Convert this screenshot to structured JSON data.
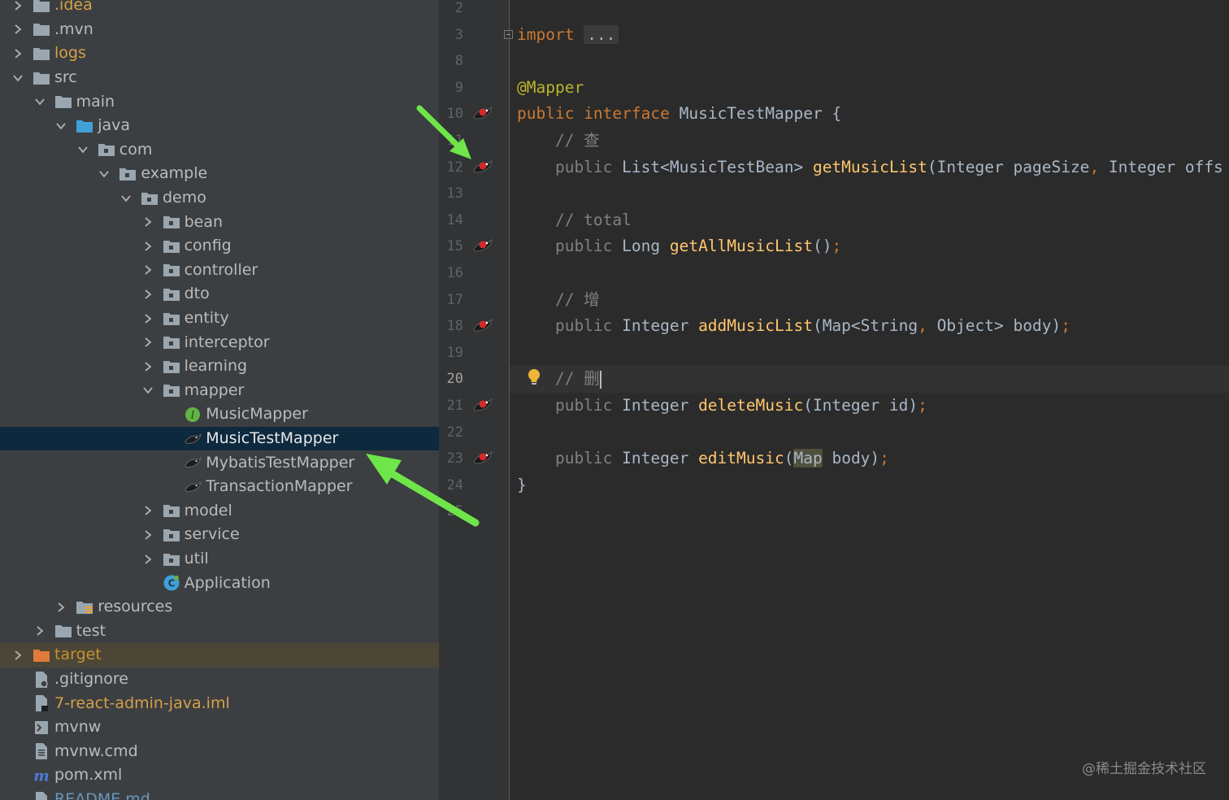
{
  "project_tree": {
    "rows": [
      {
        "label": ".idea",
        "depth": 0,
        "chev": "right",
        "icon": "folder-icon",
        "color": "orange"
      },
      {
        "label": ".mvn",
        "depth": 0,
        "chev": "right",
        "icon": "folder-icon",
        "color": "normal"
      },
      {
        "label": "logs",
        "depth": 0,
        "chev": "right",
        "icon": "folder-icon",
        "color": "orange"
      },
      {
        "label": "src",
        "depth": 0,
        "chev": "down",
        "icon": "folder-icon",
        "color": "normal"
      },
      {
        "label": "main",
        "depth": 1,
        "chev": "down",
        "icon": "folder-icon",
        "color": "normal"
      },
      {
        "label": "java",
        "depth": 2,
        "chev": "down",
        "icon": "source-folder-icon",
        "color": "normal"
      },
      {
        "label": "com",
        "depth": 3,
        "chev": "down",
        "icon": "package-icon",
        "color": "normal"
      },
      {
        "label": "example",
        "depth": 4,
        "chev": "down",
        "icon": "package-icon",
        "color": "normal"
      },
      {
        "label": "demo",
        "depth": 5,
        "chev": "down",
        "icon": "package-icon",
        "color": "normal"
      },
      {
        "label": "bean",
        "depth": 6,
        "chev": "right",
        "icon": "package-icon",
        "color": "normal"
      },
      {
        "label": "config",
        "depth": 6,
        "chev": "right",
        "icon": "package-icon",
        "color": "normal"
      },
      {
        "label": "controller",
        "depth": 6,
        "chev": "right",
        "icon": "package-icon",
        "color": "normal"
      },
      {
        "label": "dto",
        "depth": 6,
        "chev": "right",
        "icon": "package-icon",
        "color": "normal"
      },
      {
        "label": "entity",
        "depth": 6,
        "chev": "right",
        "icon": "package-icon",
        "color": "normal"
      },
      {
        "label": "interceptor",
        "depth": 6,
        "chev": "right",
        "icon": "package-icon",
        "color": "normal"
      },
      {
        "label": "learning",
        "depth": 6,
        "chev": "right",
        "icon": "package-icon",
        "color": "normal"
      },
      {
        "label": "mapper",
        "depth": 6,
        "chev": "down",
        "icon": "package-icon",
        "color": "normal"
      },
      {
        "label": "MusicMapper",
        "depth": 7,
        "chev": "none",
        "icon": "interface-icon",
        "color": "normal"
      },
      {
        "label": "MusicTestMapper",
        "depth": 7,
        "chev": "none",
        "icon": "mybatis-bird-icon",
        "color": "normal",
        "selected": true
      },
      {
        "label": "MybatisTestMapper",
        "depth": 7,
        "chev": "none",
        "icon": "mybatis-bird-icon",
        "color": "normal"
      },
      {
        "label": "TransactionMapper",
        "depth": 7,
        "chev": "none",
        "icon": "mybatis-bird-icon",
        "color": "normal"
      },
      {
        "label": "model",
        "depth": 6,
        "chev": "right",
        "icon": "package-icon",
        "color": "normal"
      },
      {
        "label": "service",
        "depth": 6,
        "chev": "right",
        "icon": "package-icon",
        "color": "normal"
      },
      {
        "label": "util",
        "depth": 6,
        "chev": "right",
        "icon": "package-icon",
        "color": "normal"
      },
      {
        "label": "Application",
        "depth": 6,
        "chev": "none",
        "icon": "spring-class-icon",
        "color": "normal"
      },
      {
        "label": "resources",
        "depth": 2,
        "chev": "right",
        "icon": "resources-folder-icon",
        "color": "normal"
      },
      {
        "label": "test",
        "depth": 1,
        "chev": "right",
        "icon": "folder-icon",
        "color": "normal"
      },
      {
        "label": "target",
        "depth": 0,
        "chev": "right",
        "icon": "excluded-folder-icon",
        "color": "target",
        "excluded": true
      },
      {
        "label": ".gitignore",
        "depth": 0,
        "chev": "none",
        "icon": "gitignore-file-icon",
        "color": "normal"
      },
      {
        "label": "7-react-admin-java.iml",
        "depth": 0,
        "chev": "none",
        "icon": "iml-file-icon",
        "color": "orange"
      },
      {
        "label": "mvnw",
        "depth": 0,
        "chev": "none",
        "icon": "shell-file-icon",
        "color": "normal"
      },
      {
        "label": "mvnw.cmd",
        "depth": 0,
        "chev": "none",
        "icon": "text-file-icon",
        "color": "normal"
      },
      {
        "label": "pom.xml",
        "depth": 0,
        "chev": "none",
        "icon": "maven-icon",
        "color": "normal"
      },
      {
        "label": "README.md",
        "depth": 0,
        "chev": "none",
        "icon": "markdown-file-icon",
        "color": "blue"
      }
    ]
  },
  "editor": {
    "lines": [
      {
        "num": "2",
        "segments": []
      },
      {
        "num": "3",
        "segments": [
          {
            "t": "import",
            "c": "kw"
          },
          {
            "t": " ",
            "c": ""
          },
          {
            "t": "...",
            "c": "fold-dots"
          }
        ],
        "fold": true
      },
      {
        "num": "8",
        "segments": []
      },
      {
        "num": "9",
        "segments": [
          {
            "t": "@Mapper",
            "c": "ann"
          }
        ]
      },
      {
        "num": "10",
        "segments": [
          {
            "t": "public ",
            "c": "kw"
          },
          {
            "t": "interface ",
            "c": "kw"
          },
          {
            "t": "MusicTestMapper {",
            "c": ""
          }
        ],
        "mark": true
      },
      {
        "num": "11",
        "segments": [
          {
            "t": "    // 查",
            "c": "cm"
          }
        ]
      },
      {
        "num": "12",
        "segments": [
          {
            "t": "    public ",
            "c": "pub"
          },
          {
            "t": "List<MusicTestBean> ",
            "c": ""
          },
          {
            "t": "getMusicList",
            "c": "fn"
          },
          {
            "t": "(Integer pageSize",
            "c": ""
          },
          {
            "t": ", ",
            "c": "kw"
          },
          {
            "t": "Integer offs",
            "c": ""
          }
        ],
        "mark": true
      },
      {
        "num": "13",
        "segments": []
      },
      {
        "num": "14",
        "segments": [
          {
            "t": "    // total",
            "c": "cm"
          }
        ]
      },
      {
        "num": "15",
        "segments": [
          {
            "t": "    public ",
            "c": "pub"
          },
          {
            "t": "Long ",
            "c": ""
          },
          {
            "t": "getAllMusicList",
            "c": "fn"
          },
          {
            "t": "()",
            "c": ""
          },
          {
            "t": ";",
            "c": "kw"
          }
        ],
        "mark": true
      },
      {
        "num": "16",
        "segments": []
      },
      {
        "num": "17",
        "segments": [
          {
            "t": "    // 增",
            "c": "cm"
          }
        ]
      },
      {
        "num": "18",
        "segments": [
          {
            "t": "    public ",
            "c": "pub"
          },
          {
            "t": "Integer ",
            "c": ""
          },
          {
            "t": "addMusicList",
            "c": "fn"
          },
          {
            "t": "(Map<String",
            "c": ""
          },
          {
            "t": ", ",
            "c": "kw"
          },
          {
            "t": "Object> body)",
            "c": ""
          },
          {
            "t": ";",
            "c": "kw"
          }
        ],
        "mark": true
      },
      {
        "num": "19",
        "segments": []
      },
      {
        "num": "20",
        "segments": [
          {
            "t": "    // 删",
            "c": "cm"
          }
        ],
        "current": true,
        "bulb": true,
        "caret": true
      },
      {
        "num": "21",
        "segments": [
          {
            "t": "    public ",
            "c": "pub"
          },
          {
            "t": "Integer ",
            "c": ""
          },
          {
            "t": "deleteMusic",
            "c": "fn"
          },
          {
            "t": "(Integer id)",
            "c": ""
          },
          {
            "t": ";",
            "c": "kw"
          }
        ],
        "mark": true
      },
      {
        "num": "22",
        "segments": []
      },
      {
        "num": "23",
        "segments": [
          {
            "t": "    public ",
            "c": "pub"
          },
          {
            "t": "Integer ",
            "c": ""
          },
          {
            "t": "editMusic",
            "c": "fn"
          },
          {
            "t": "(",
            "c": ""
          },
          {
            "t": "Map",
            "c": "map-hl"
          },
          {
            "t": " body)",
            "c": ""
          },
          {
            "t": ";",
            "c": "kw"
          }
        ],
        "mark": true
      },
      {
        "num": "24",
        "segments": [
          {
            "t": "}",
            "c": ""
          }
        ]
      },
      {
        "num": "25",
        "segments": []
      }
    ]
  },
  "watermark": "@稀土掘金技术社区",
  "colors": {
    "tree_bg": "#3c3f41",
    "editor_bg": "#2b2b2b",
    "selection": "#0d293e",
    "arrow": "#6ee64a",
    "keyword": "#cc7832",
    "function": "#ffc66d",
    "annotation": "#bbb529"
  }
}
